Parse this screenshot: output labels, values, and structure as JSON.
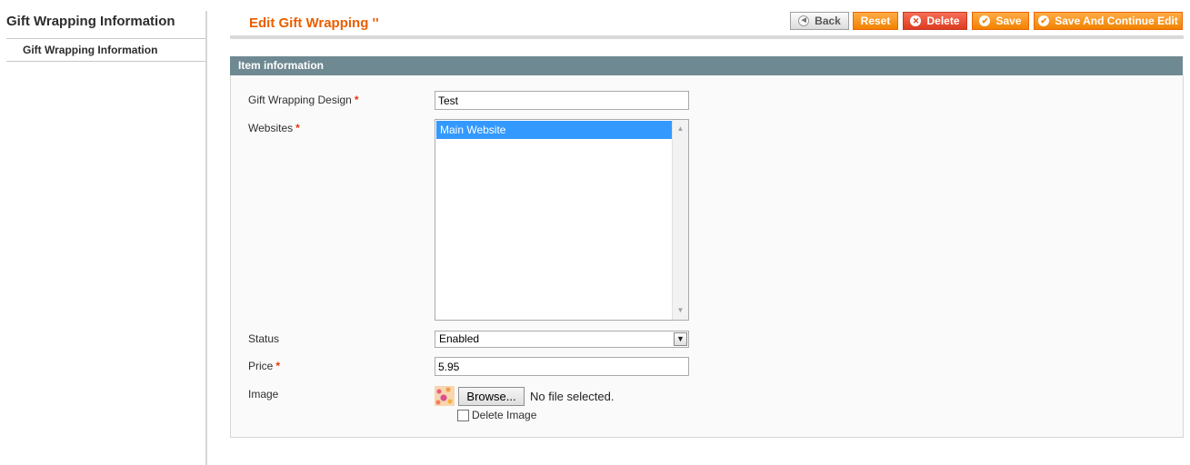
{
  "sidebar": {
    "title": "Gift Wrapping Information",
    "tabs": [
      {
        "label": "Gift Wrapping Information"
      }
    ]
  },
  "header": {
    "title": "Edit Gift Wrapping ''",
    "buttons": {
      "back": "Back",
      "reset": "Reset",
      "delete": "Delete",
      "save": "Save",
      "save_continue": "Save And Continue Edit"
    }
  },
  "form": {
    "section_title": "Item information",
    "design": {
      "label": "Gift Wrapping Design",
      "required": "*",
      "value": "Test"
    },
    "websites": {
      "label": "Websites",
      "required": "*",
      "options": [
        "Main Website"
      ],
      "selected": "Main Website"
    },
    "status": {
      "label": "Status",
      "value": "Enabled"
    },
    "price": {
      "label": "Price",
      "required": "*",
      "value": "5.95"
    },
    "image": {
      "label": "Image",
      "browse_label": "Browse...",
      "file_status": "No file selected.",
      "delete_label": "Delete Image"
    }
  },
  "colors": {
    "accent": "#eb5e00",
    "section_header": "#6f8992",
    "selection": "#3399ff"
  }
}
